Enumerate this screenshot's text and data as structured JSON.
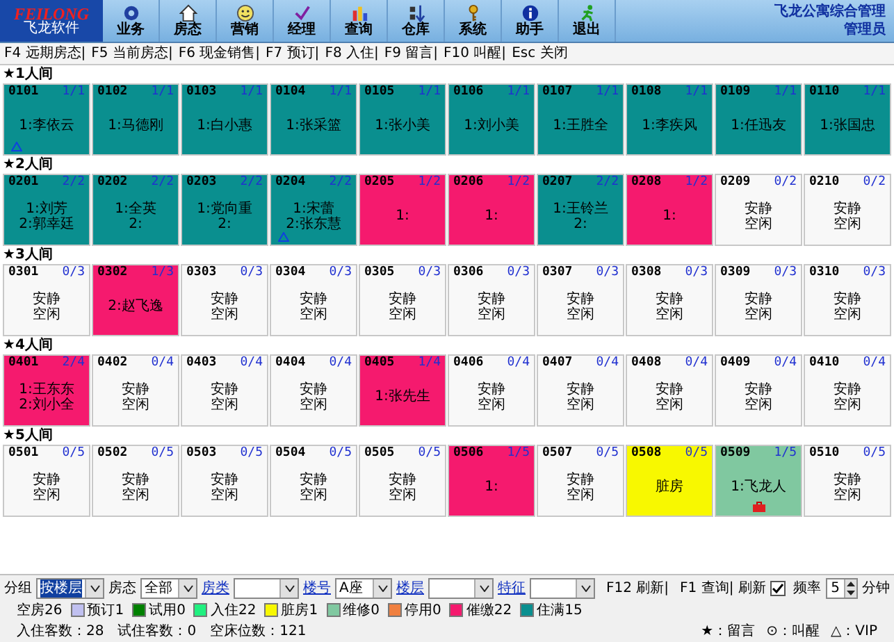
{
  "header": {
    "brand": "FEILONG",
    "subtitle": "飞龙软件",
    "app_title": "飞龙公寓综合管理",
    "user": "管理员",
    "menu": [
      "业务",
      "房态",
      "营销",
      "经理",
      "查询",
      "仓库",
      "系统",
      "助手",
      "退出"
    ]
  },
  "shortcuts": [
    "F4 远期房态|",
    "F5 当前房态|",
    "F6 现金销售|",
    "F7 预订|",
    "F8 入住|",
    "F9 留言|",
    "F10 叫醒|",
    "Esc 关闭"
  ],
  "groups": [
    {
      "title": "★1人间",
      "rooms": [
        {
          "number": "0101",
          "capacity": "1/1",
          "color": "#0a8f8f",
          "lines": [
            "1:李依云"
          ],
          "vip": true,
          "luggage": false
        },
        {
          "number": "0102",
          "capacity": "1/1",
          "color": "#0a8f8f",
          "lines": [
            "1:马德刚"
          ],
          "vip": false,
          "luggage": false
        },
        {
          "number": "0103",
          "capacity": "1/1",
          "color": "#0a8f8f",
          "lines": [
            "1:白小惠"
          ],
          "vip": false,
          "luggage": false
        },
        {
          "number": "0104",
          "capacity": "1/1",
          "color": "#0a8f8f",
          "lines": [
            "1:张采篮"
          ],
          "vip": false,
          "luggage": false
        },
        {
          "number": "0105",
          "capacity": "1/1",
          "color": "#0a8f8f",
          "lines": [
            "1:张小美"
          ],
          "vip": false,
          "luggage": false
        },
        {
          "number": "0106",
          "capacity": "1/1",
          "color": "#0a8f8f",
          "lines": [
            "1:刘小美"
          ],
          "vip": false,
          "luggage": false
        },
        {
          "number": "0107",
          "capacity": "1/1",
          "color": "#0a8f8f",
          "lines": [
            "1:王胜全"
          ],
          "vip": false,
          "luggage": false
        },
        {
          "number": "0108",
          "capacity": "1/1",
          "color": "#0a8f8f",
          "lines": [
            "1:李疾风"
          ],
          "vip": false,
          "luggage": false
        },
        {
          "number": "0109",
          "capacity": "1/1",
          "color": "#0a8f8f",
          "lines": [
            "1:任迅友"
          ],
          "vip": false,
          "luggage": false
        },
        {
          "number": "0110",
          "capacity": "1/1",
          "color": "#0a8f8f",
          "lines": [
            "1:张国忠"
          ],
          "vip": false,
          "luggage": false
        }
      ]
    },
    {
      "title": "★2人间",
      "rooms": [
        {
          "number": "0201",
          "capacity": "2/2",
          "color": "#0a8f8f",
          "lines": [
            "1:刘芳",
            "2:郭幸廷"
          ],
          "vip": false,
          "luggage": false
        },
        {
          "number": "0202",
          "capacity": "2/2",
          "color": "#0a8f8f",
          "lines": [
            "1:全英",
            "2:"
          ],
          "vip": false,
          "luggage": false
        },
        {
          "number": "0203",
          "capacity": "2/2",
          "color": "#0a8f8f",
          "lines": [
            "1:党向重",
            "2:"
          ],
          "vip": false,
          "luggage": false
        },
        {
          "number": "0204",
          "capacity": "2/2",
          "color": "#0a8f8f",
          "lines": [
            "1:宋蕾",
            "2:张东慧"
          ],
          "vip": true,
          "luggage": false
        },
        {
          "number": "0205",
          "capacity": "1/2",
          "color": "#f51a6e",
          "lines": [
            "1:"
          ],
          "vip": false,
          "luggage": false
        },
        {
          "number": "0206",
          "capacity": "1/2",
          "color": "#f51a6e",
          "lines": [
            "1:"
          ],
          "vip": false,
          "luggage": false
        },
        {
          "number": "0207",
          "capacity": "2/2",
          "color": "#0a8f8f",
          "lines": [
            "1:王铃兰",
            "2:"
          ],
          "vip": false,
          "luggage": false
        },
        {
          "number": "0208",
          "capacity": "1/2",
          "color": "#f51a6e",
          "lines": [
            "1:"
          ],
          "vip": false,
          "luggage": false
        },
        {
          "number": "0209",
          "capacity": "0/2",
          "color": "#f8f8f8",
          "lines": [
            "安静",
            "空闲"
          ],
          "vip": false,
          "luggage": false
        },
        {
          "number": "0210",
          "capacity": "0/2",
          "color": "#f8f8f8",
          "lines": [
            "安静",
            "空闲"
          ],
          "vip": false,
          "luggage": false
        }
      ]
    },
    {
      "title": "★3人间",
      "rooms": [
        {
          "number": "0301",
          "capacity": "0/3",
          "color": "#f8f8f8",
          "lines": [
            "安静",
            "空闲"
          ],
          "vip": false,
          "luggage": false
        },
        {
          "number": "0302",
          "capacity": "1/3",
          "color": "#f51a6e",
          "lines": [
            "2:赵飞逸"
          ],
          "vip": false,
          "luggage": false
        },
        {
          "number": "0303",
          "capacity": "0/3",
          "color": "#f8f8f8",
          "lines": [
            "安静",
            "空闲"
          ],
          "vip": false,
          "luggage": false
        },
        {
          "number": "0304",
          "capacity": "0/3",
          "color": "#f8f8f8",
          "lines": [
            "安静",
            "空闲"
          ],
          "vip": false,
          "luggage": false
        },
        {
          "number": "0305",
          "capacity": "0/3",
          "color": "#f8f8f8",
          "lines": [
            "安静",
            "空闲"
          ],
          "vip": false,
          "luggage": false
        },
        {
          "number": "0306",
          "capacity": "0/3",
          "color": "#f8f8f8",
          "lines": [
            "安静",
            "空闲"
          ],
          "vip": false,
          "luggage": false
        },
        {
          "number": "0307",
          "capacity": "0/3",
          "color": "#f8f8f8",
          "lines": [
            "安静",
            "空闲"
          ],
          "vip": false,
          "luggage": false
        },
        {
          "number": "0308",
          "capacity": "0/3",
          "color": "#f8f8f8",
          "lines": [
            "安静",
            "空闲"
          ],
          "vip": false,
          "luggage": false
        },
        {
          "number": "0309",
          "capacity": "0/3",
          "color": "#f8f8f8",
          "lines": [
            "安静",
            "空闲"
          ],
          "vip": false,
          "luggage": false
        },
        {
          "number": "0310",
          "capacity": "0/3",
          "color": "#f8f8f8",
          "lines": [
            "安静",
            "空闲"
          ],
          "vip": false,
          "luggage": false
        }
      ]
    },
    {
      "title": "★4人间",
      "rooms": [
        {
          "number": "0401",
          "capacity": "2/4",
          "color": "#f51a6e",
          "lines": [
            "1:王东东",
            "2:刘小全"
          ],
          "vip": false,
          "luggage": false
        },
        {
          "number": "0402",
          "capacity": "0/4",
          "color": "#f8f8f8",
          "lines": [
            "安静",
            "空闲"
          ],
          "vip": false,
          "luggage": false
        },
        {
          "number": "0403",
          "capacity": "0/4",
          "color": "#f8f8f8",
          "lines": [
            "安静",
            "空闲"
          ],
          "vip": false,
          "luggage": false
        },
        {
          "number": "0404",
          "capacity": "0/4",
          "color": "#f8f8f8",
          "lines": [
            "安静",
            "空闲"
          ],
          "vip": false,
          "luggage": false
        },
        {
          "number": "0405",
          "capacity": "1/4",
          "color": "#f51a6e",
          "lines": [
            "1:张先生"
          ],
          "vip": false,
          "luggage": false
        },
        {
          "number": "0406",
          "capacity": "0/4",
          "color": "#f8f8f8",
          "lines": [
            "安静",
            "空闲"
          ],
          "vip": false,
          "luggage": false
        },
        {
          "number": "0407",
          "capacity": "0/4",
          "color": "#f8f8f8",
          "lines": [
            "安静",
            "空闲"
          ],
          "vip": false,
          "luggage": false
        },
        {
          "number": "0408",
          "capacity": "0/4",
          "color": "#f8f8f8",
          "lines": [
            "安静",
            "空闲"
          ],
          "vip": false,
          "luggage": false
        },
        {
          "number": "0409",
          "capacity": "0/4",
          "color": "#f8f8f8",
          "lines": [
            "安静",
            "空闲"
          ],
          "vip": false,
          "luggage": false
        },
        {
          "number": "0410",
          "capacity": "0/4",
          "color": "#f8f8f8",
          "lines": [
            "安静",
            "空闲"
          ],
          "vip": false,
          "luggage": false
        }
      ]
    },
    {
      "title": "★5人间",
      "rooms": [
        {
          "number": "0501",
          "capacity": "0/5",
          "color": "#f8f8f8",
          "lines": [
            "安静",
            "空闲"
          ],
          "vip": false,
          "luggage": false
        },
        {
          "number": "0502",
          "capacity": "0/5",
          "color": "#f8f8f8",
          "lines": [
            "安静",
            "空闲"
          ],
          "vip": false,
          "luggage": false
        },
        {
          "number": "0503",
          "capacity": "0/5",
          "color": "#f8f8f8",
          "lines": [
            "安静",
            "空闲"
          ],
          "vip": false,
          "luggage": false
        },
        {
          "number": "0504",
          "capacity": "0/5",
          "color": "#f8f8f8",
          "lines": [
            "安静",
            "空闲"
          ],
          "vip": false,
          "luggage": false
        },
        {
          "number": "0505",
          "capacity": "0/5",
          "color": "#f8f8f8",
          "lines": [
            "安静",
            "空闲"
          ],
          "vip": false,
          "luggage": false
        },
        {
          "number": "0506",
          "capacity": "1/5",
          "color": "#f51a6e",
          "lines": [
            "1:"
          ],
          "vip": false,
          "luggage": false
        },
        {
          "number": "0507",
          "capacity": "0/5",
          "color": "#f8f8f8",
          "lines": [
            "安静",
            "空闲"
          ],
          "vip": false,
          "luggage": false
        },
        {
          "number": "0508",
          "capacity": "0/5",
          "color": "#f8f800",
          "lines": [
            "脏房"
          ],
          "vip": false,
          "luggage": false
        },
        {
          "number": "0509",
          "capacity": "1/5",
          "color": "#80c8a0",
          "lines": [
            "1:飞龙人"
          ],
          "vip": false,
          "luggage": true
        },
        {
          "number": "0510",
          "capacity": "0/5",
          "color": "#f8f8f8",
          "lines": [
            "安静",
            "空闲"
          ],
          "vip": false,
          "luggage": false
        }
      ]
    }
  ],
  "filters": [
    {
      "label": "分组",
      "link": false,
      "value": "按楼层",
      "focused": true
    },
    {
      "label": "房态",
      "link": false,
      "value": "全部",
      "focused": false
    },
    {
      "label": "房类",
      "link": true,
      "focused": false
    },
    {
      "label": "楼号",
      "link": true,
      "value": "A座",
      "focused": false
    },
    {
      "label": "楼层",
      "link": true,
      "focused": false
    },
    {
      "label": "特征",
      "link": true,
      "focused": false
    }
  ],
  "hotkeys": [
    "F12 刷新|",
    "F1 查询|"
  ],
  "refresh": {
    "label": "刷新",
    "checked": true
  },
  "frequency": {
    "label": "频率",
    "value": "5",
    "unit": "分钟"
  },
  "legend": [
    {
      "label": "空房26"
    },
    {
      "label": "预订1",
      "color": "#c0c0f0"
    },
    {
      "label": "试用0",
      "color": "#008000"
    },
    {
      "label": "入住22",
      "color": "#20f080"
    },
    {
      "label": "脏房1",
      "color": "#f8f800"
    },
    {
      "label": "维修0",
      "color": "#80c8a0"
    },
    {
      "label": "停用0",
      "color": "#f08040"
    },
    {
      "label": "催缴22",
      "color": "#f51a6e"
    },
    {
      "label": "住满15",
      "color": "#0a8f8f"
    }
  ],
  "stats": [
    "入住客数：28",
    "试住客数：0",
    "空床位数：121"
  ],
  "key": [
    "★：留言",
    "⊙：叫醒",
    "△：VIP"
  ]
}
